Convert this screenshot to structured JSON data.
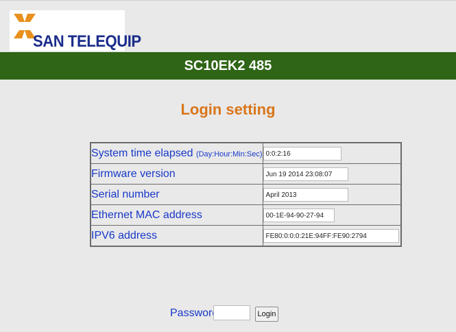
{
  "header": {
    "logo_text": "SAN TELEQUIP",
    "banner_title": "SC10EK2 485"
  },
  "colors": {
    "banner": "#2f6516",
    "heading": "#d9761a",
    "label": "#1838c8",
    "logo_text": "#1a2d8c",
    "logo_mark": "#e8901e"
  },
  "page": {
    "heading": "Login setting"
  },
  "info": {
    "rows": [
      {
        "label": "System time elapsed ",
        "sublabel": "(Day:Hour:Min:Sec)",
        "value": "0:0:2:16"
      },
      {
        "label": "Firmware version",
        "sublabel": "",
        "value": "Jun 19 2014 23:08:07"
      },
      {
        "label": "Serial number",
        "sublabel": "",
        "value": "April 2013"
      },
      {
        "label": "Ethernet MAC address",
        "sublabel": "",
        "value": "00-1E-94-90-27-94"
      },
      {
        "label": "IPV6 address",
        "sublabel": "",
        "value": "FE80:0:0:0:21E:94FF:FE90:2794"
      }
    ]
  },
  "login": {
    "password_label": "Password",
    "password_value": "",
    "button_label": "Login"
  }
}
